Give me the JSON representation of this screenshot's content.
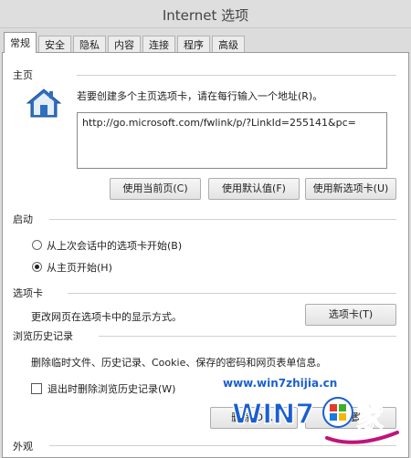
{
  "window": {
    "title": "Internet 选项"
  },
  "tabs": [
    {
      "label": "常规",
      "active": true
    },
    {
      "label": "安全"
    },
    {
      "label": "隐私"
    },
    {
      "label": "内容"
    },
    {
      "label": "连接"
    },
    {
      "label": "程序"
    },
    {
      "label": "高级"
    }
  ],
  "homepage": {
    "section_title": "主页",
    "hint": "若要创建多个主页选项卡，请在每行输入一个地址(R)。",
    "url_value": "http://go.microsoft.com/fwlink/p/?LinkId=255141&pc=",
    "buttons": {
      "use_current": "使用当前页(C)",
      "use_default": "使用默认值(F)",
      "use_new_tab": "使用新选项卡(U)"
    }
  },
  "startup": {
    "section_title": "启动",
    "options": [
      {
        "label": "从上次会话中的选项卡开始(B)",
        "checked": false
      },
      {
        "label": "从主页开始(H)",
        "checked": true
      }
    ]
  },
  "tabs_section": {
    "section_title": "选项卡",
    "description": "更改网页在选项卡中的显示方式。",
    "button": "选项卡(T)"
  },
  "history": {
    "section_title": "浏览历史记录",
    "description": "删除临时文件、历史记录、Cookie、保存的密码和网页表单信息。",
    "checkbox_label": "退出时删除浏览历史记录(W)",
    "checkbox_checked": false,
    "delete_button": "删除(D)...",
    "settings_button": "设置"
  },
  "appearance": {
    "section_title": "外观"
  },
  "watermark": {
    "url": "www.win7zhijia.cn",
    "logo_text": "WIN7",
    "logo_suffix": "家"
  },
  "colors": {
    "window_bg": "#dcdcdc",
    "panel_bg": "#ffffff",
    "home_icon_blue": "#2f6fc0",
    "watermark_blue": "#1a5fd0",
    "watermark_magenta": "#c0147a"
  }
}
